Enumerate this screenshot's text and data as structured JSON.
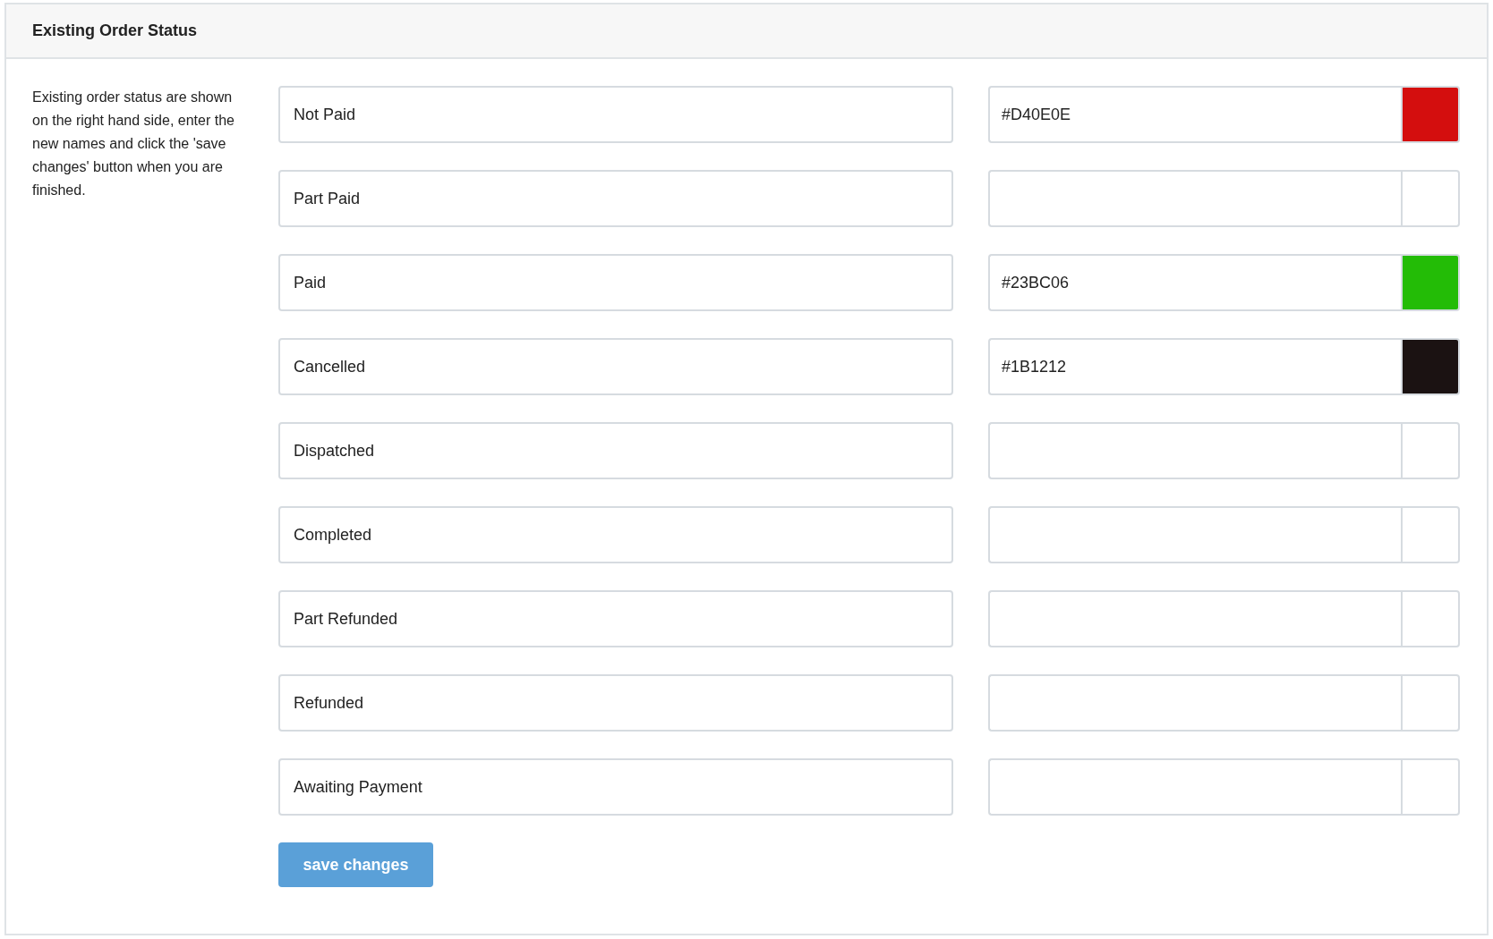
{
  "panel": {
    "title": "Existing Order Status",
    "description": "Existing order status are shown on the right hand side, enter the new names and click the 'save changes' button when you are finished."
  },
  "rows": [
    {
      "name": "Not Paid",
      "color_value": "#D40E0E",
      "color": "#d40e0e"
    },
    {
      "name": "Part Paid"
    },
    {
      "name": "Paid",
      "color_value": "#23BC06",
      "color": "#23bc06"
    },
    {
      "name": "Cancelled",
      "color_value": "#1B1212",
      "color": "#1b1212"
    },
    {
      "name": "Dispatched"
    },
    {
      "name": "Completed"
    },
    {
      "name": "Part Refunded"
    },
    {
      "name": "Refunded"
    },
    {
      "name": "Awaiting Payment"
    }
  ],
  "button": "save changes"
}
